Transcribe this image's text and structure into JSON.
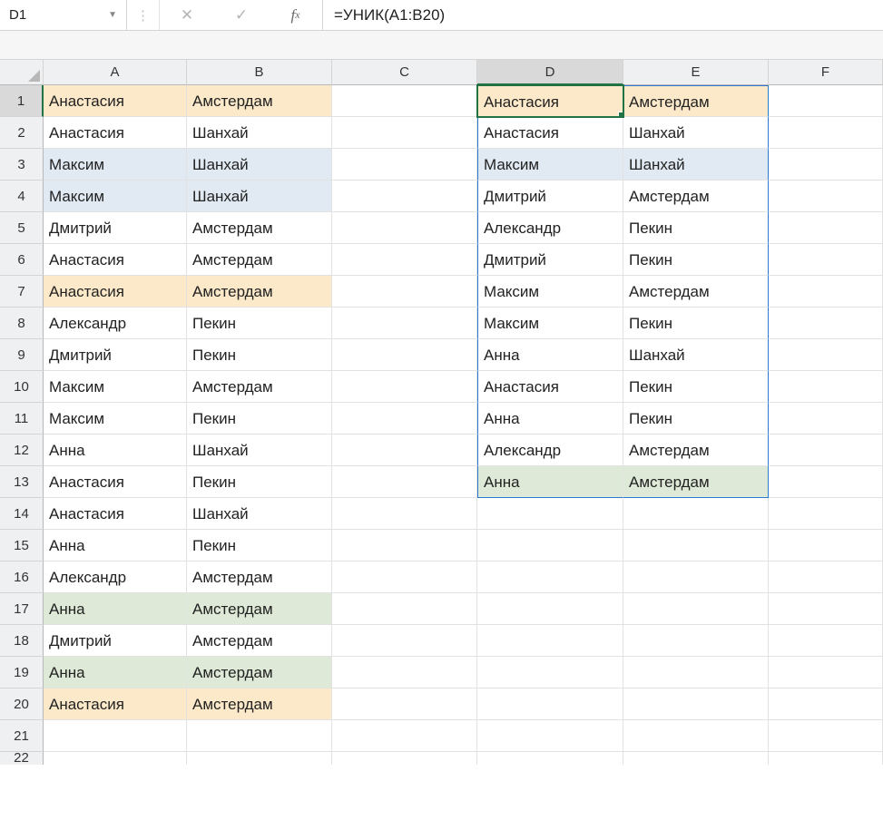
{
  "nameBox": "D1",
  "formula": "=УНИК(A1:B20)",
  "columns": [
    "A",
    "B",
    "C",
    "D",
    "E",
    "F"
  ],
  "rowCount": 21,
  "selectedCell": {
    "col": "D",
    "row": 1
  },
  "spillRange": {
    "startCol": "D",
    "endCol": "E",
    "startRow": 1,
    "endRow": 13
  },
  "cells": {
    "A1": {
      "v": "Анастасия",
      "hl": "yellow"
    },
    "B1": {
      "v": "Амстердам",
      "hl": "yellow"
    },
    "A2": {
      "v": "Анастасия"
    },
    "B2": {
      "v": "Шанхай"
    },
    "A3": {
      "v": "Максим",
      "hl": "blue"
    },
    "B3": {
      "v": "Шанхай",
      "hl": "blue"
    },
    "A4": {
      "v": "Максим",
      "hl": "blue"
    },
    "B4": {
      "v": "Шанхай",
      "hl": "blue"
    },
    "A5": {
      "v": "Дмитрий"
    },
    "B5": {
      "v": "Амстердам"
    },
    "A6": {
      "v": "Анастасия"
    },
    "B6": {
      "v": "Амстердам"
    },
    "A7": {
      "v": "Анастасия",
      "hl": "yellow"
    },
    "B7": {
      "v": "Амстердам",
      "hl": "yellow"
    },
    "A8": {
      "v": "Александр"
    },
    "B8": {
      "v": "Пекин"
    },
    "A9": {
      "v": "Дмитрий"
    },
    "B9": {
      "v": "Пекин"
    },
    "A10": {
      "v": "Максим"
    },
    "B10": {
      "v": "Амстердам"
    },
    "A11": {
      "v": "Максим"
    },
    "B11": {
      "v": "Пекин"
    },
    "A12": {
      "v": "Анна"
    },
    "B12": {
      "v": "Шанхай"
    },
    "A13": {
      "v": "Анастасия"
    },
    "B13": {
      "v": "Пекин"
    },
    "A14": {
      "v": "Анастасия"
    },
    "B14": {
      "v": "Шанхай"
    },
    "A15": {
      "v": "Анна"
    },
    "B15": {
      "v": "Пекин"
    },
    "A16": {
      "v": "Александр"
    },
    "B16": {
      "v": "Амстердам"
    },
    "A17": {
      "v": "Анна",
      "hl": "green"
    },
    "B17": {
      "v": "Амстердам",
      "hl": "green"
    },
    "A18": {
      "v": "Дмитрий"
    },
    "B18": {
      "v": "Амстердам"
    },
    "A19": {
      "v": "Анна",
      "hl": "green"
    },
    "B19": {
      "v": "Амстердам",
      "hl": "green"
    },
    "A20": {
      "v": "Анастасия",
      "hl": "yellow"
    },
    "B20": {
      "v": "Амстердам",
      "hl": "yellow"
    },
    "D1": {
      "v": "Анастасия",
      "hl": "yellow"
    },
    "E1": {
      "v": "Амстердам",
      "hl": "yellow"
    },
    "D2": {
      "v": "Анастасия"
    },
    "E2": {
      "v": "Шанхай"
    },
    "D3": {
      "v": "Максим",
      "hl": "blue"
    },
    "E3": {
      "v": "Шанхай",
      "hl": "blue"
    },
    "D4": {
      "v": "Дмитрий"
    },
    "E4": {
      "v": "Амстердам"
    },
    "D5": {
      "v": "Александр"
    },
    "E5": {
      "v": "Пекин"
    },
    "D6": {
      "v": "Дмитрий"
    },
    "E6": {
      "v": "Пекин"
    },
    "D7": {
      "v": "Максим"
    },
    "E7": {
      "v": "Амстердам"
    },
    "D8": {
      "v": "Максим"
    },
    "E8": {
      "v": "Пекин"
    },
    "D9": {
      "v": "Анна"
    },
    "E9": {
      "v": "Шанхай"
    },
    "D10": {
      "v": "Анастасия"
    },
    "E10": {
      "v": "Пекин"
    },
    "D11": {
      "v": "Анна"
    },
    "E11": {
      "v": "Пекин"
    },
    "D12": {
      "v": "Александр"
    },
    "E12": {
      "v": "Амстердам"
    },
    "D13": {
      "v": "Анна",
      "hl": "green"
    },
    "E13": {
      "v": "Амстердам",
      "hl": "green"
    }
  }
}
